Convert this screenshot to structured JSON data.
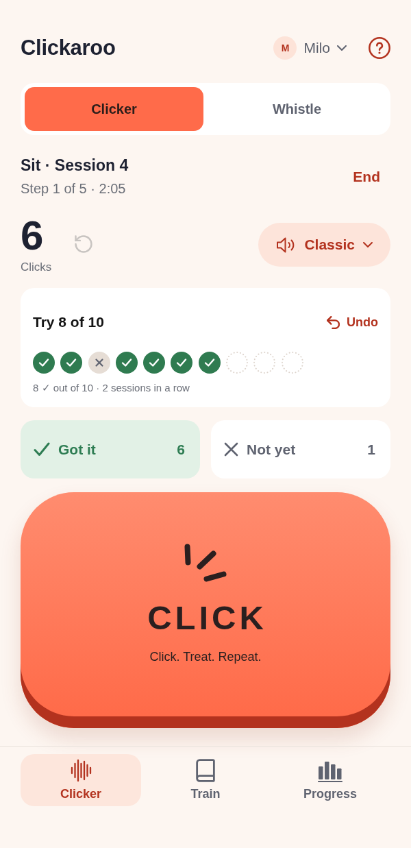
{
  "app": {
    "title": "Clickaroo"
  },
  "profile": {
    "initial": "M",
    "name": "Milo"
  },
  "mode_tabs": [
    {
      "label": "Clicker",
      "selected": true
    },
    {
      "label": "Whistle",
      "selected": false
    }
  ],
  "session": {
    "title": "Sit · Session 4",
    "subtitle": "Step 1 of 5 · 2:05",
    "end_label": "End"
  },
  "counter": {
    "value": "6",
    "label": "Clicks",
    "reset_disabled": true
  },
  "sound": {
    "label": "Classic"
  },
  "attempts_card": {
    "title": "Try 8 of 10",
    "undo_label": "Undo",
    "attempts": [
      {
        "kind": "success"
      },
      {
        "kind": "success"
      },
      {
        "kind": "miss"
      },
      {
        "kind": "success"
      },
      {
        "kind": "success"
      },
      {
        "kind": "success"
      },
      {
        "kind": "success"
      },
      {
        "kind": "pending"
      },
      {
        "kind": "pending"
      },
      {
        "kind": "pending"
      }
    ],
    "summary": "8 ✓ out of 10 · 2 sessions in a row"
  },
  "tallies": [
    {
      "kind": "yes",
      "label": "Got it",
      "count": "6"
    },
    {
      "kind": "no",
      "label": "Not yet",
      "count": "1"
    }
  ],
  "click_button": {
    "label": "CLICK",
    "tagline": "Click. Treat. Repeat."
  },
  "bottom_nav": [
    {
      "label": "Clicker",
      "selected": true
    },
    {
      "label": "Train",
      "selected": false
    },
    {
      "label": "Progress",
      "selected": false
    }
  ]
}
